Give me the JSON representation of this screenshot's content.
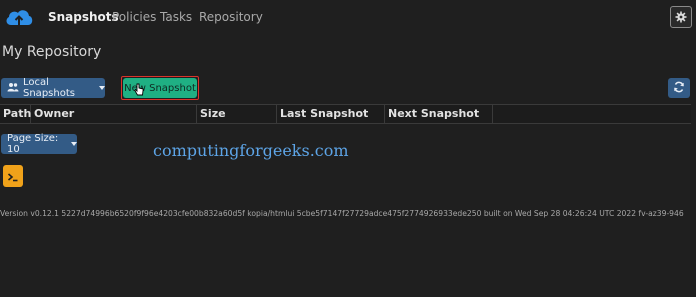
{
  "nav": {
    "links": [
      "Snapshots",
      "Policies",
      "Tasks",
      "Repository"
    ],
    "active": "Snapshots",
    "logo_icon": "cloud-upload-icon",
    "settings_icon": "gear-icon"
  },
  "page": {
    "title": "My Repository"
  },
  "toolbar": {
    "local_snapshots_label": "Local Snapshots",
    "new_snapshot_label": "New Snapshot",
    "refresh_icon": "refresh-icon"
  },
  "table": {
    "headers": [
      "Path",
      "Owner",
      "Size",
      "Last Snapshot",
      "Next Snapshot"
    ]
  },
  "pager": {
    "page_size_label": "Page Size: 10"
  },
  "watermark": "computingforgeeks.com",
  "footer": {
    "version": "Version v0.12.1 5227d74996b6520f9f96e4203cfe00b832a60d5f kopia/htmlui 5cbe5f7147f27729adce475f2774926933ede250 built on Wed Sep 28 04:26:24 UTC 2022 fv-az39-946"
  },
  "colors": {
    "background": "#1f1f1f",
    "primary": "#335b86",
    "success": "#1fb083",
    "highlight": "#d9342b",
    "terminal": "#f0a21a",
    "logo": "#2f8ee6"
  }
}
